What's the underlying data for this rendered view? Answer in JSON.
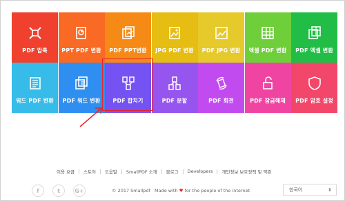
{
  "tiles": [
    {
      "label": "PDF 압축",
      "color": "#f0412e",
      "icon": "compress-icon"
    },
    {
      "label": "PPT PDF 변환",
      "color": "#f96a24",
      "icon": "ppt-to-pdf-icon"
    },
    {
      "label": "PDF PPT변환",
      "color": "#f58b16",
      "icon": "pdf-to-ppt-icon"
    },
    {
      "label": "JPG PDF 변환",
      "color": "#e6bd12",
      "icon": "jpg-to-pdf-icon"
    },
    {
      "label": "PDF JPG 변환",
      "color": "#e6c92a",
      "icon": "pdf-to-jpg-icon"
    },
    {
      "label": "엑셀 PDF 변환",
      "color": "#6fcf3a",
      "icon": "excel-to-pdf-icon"
    },
    {
      "label": "PDF 엑셀 변환",
      "color": "#21bd46",
      "icon": "pdf-to-excel-icon"
    },
    {
      "label": "워드 PDF 변환",
      "color": "#37bbe8",
      "icon": "word-to-pdf-icon"
    },
    {
      "label": "PDF 워드 변환",
      "color": "#2f8ff0",
      "icon": "pdf-to-word-icon"
    },
    {
      "label": "PDF 합치기",
      "color": "#7552f2",
      "icon": "merge-icon"
    },
    {
      "label": "PDF 분할",
      "color": "#9655ee",
      "icon": "split-icon"
    },
    {
      "label": "PDF 회전",
      "color": "#c24bf0",
      "icon": "rotate-icon"
    },
    {
      "label": "PDF 잠금해제",
      "color": "#f044a2",
      "icon": "unlock-icon"
    },
    {
      "label": "PDF 암호 설정",
      "color": "#f2476a",
      "icon": "shield-icon"
    }
  ],
  "footer": {
    "links": [
      "이용 요금",
      "스토어",
      "도움말",
      "SmallPDF 소개",
      "블로그",
      "Developers",
      "개인정보 보호정책 및 약관"
    ],
    "copyright_prefix": "© 2017 Smallpdf",
    "copyright_made": "Made with",
    "copyright_heart": "♥",
    "copyright_suffix": "for the people of the internet",
    "language": "한국어",
    "social": [
      "f",
      "t",
      "G+"
    ]
  }
}
